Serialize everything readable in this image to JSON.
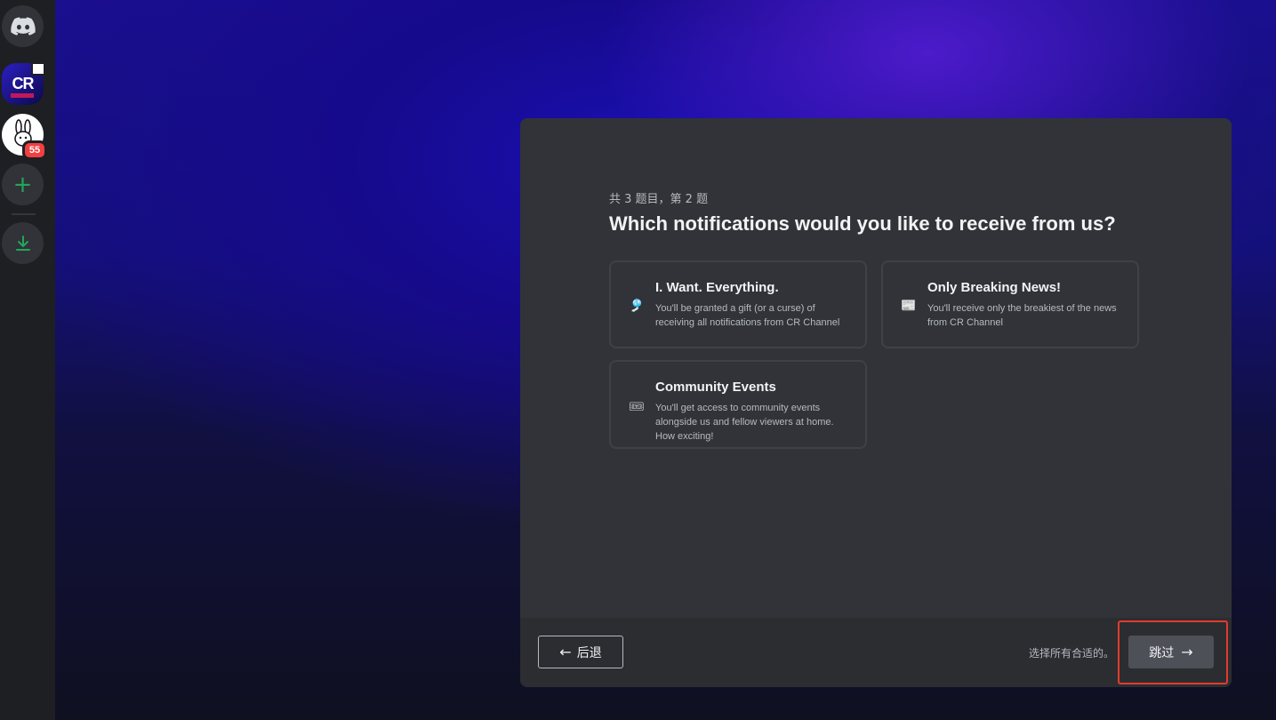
{
  "server_rail": {
    "discord_home": "discord-logo",
    "servers": [
      {
        "name": "CR Channel",
        "icon_text": "CR"
      },
      {
        "name": "rabbit-server",
        "unread_count": "55"
      }
    ],
    "add_server": "+",
    "download": "download-icon"
  },
  "onboarding": {
    "progress": "共 3 题目，第 2 题",
    "question": "Which notifications would you like to receive from us?",
    "options": [
      {
        "icon": "🎐",
        "title": "I. Want. Everything.",
        "description": "You'll be granted a gift (or a curse) of receiving all notifications from CR Channel"
      },
      {
        "icon": "📰",
        "title": "Only Breaking News!",
        "description": "You'll receive only the breakiest of the news from CR Channel"
      },
      {
        "icon": "🎟",
        "title": "Community Events",
        "description": "You'll get access to community events alongside us and fellow viewers at home. How exciting!"
      }
    ],
    "footer": {
      "back_label": "后退",
      "hint": "选择所有合适的。",
      "skip_label": "跳过"
    }
  },
  "colors": {
    "modal_bg": "#313338",
    "footer_bg": "#2b2d31",
    "rail_bg": "#1e1f22",
    "highlight": "#e33b2e",
    "unread": "#f23f42"
  }
}
